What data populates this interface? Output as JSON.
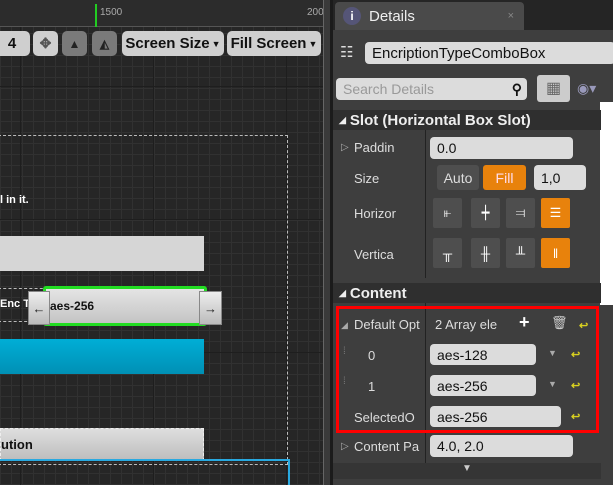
{
  "viewport": {
    "ruler_labels": [
      "1500",
      "200"
    ],
    "toolbar": {
      "dpi_value": "4",
      "screen_size": "Screen Size",
      "fill_screen": "Fill Screen"
    },
    "canvas": {
      "hint_text": "l in it.",
      "enc_label": "Enc Ty",
      "combo_value": "aes-256",
      "left_arrow": "←",
      "right_arrow": "→",
      "button_text": "ution"
    }
  },
  "details": {
    "tab_title": "Details",
    "close": "×",
    "widget_name": "EncriptionTypeComboBox",
    "search_placeholder": "Search Details",
    "slot_section": "Slot (Horizontal Box Slot)",
    "padding_label": "Paddin",
    "padding_value": "0.0",
    "size_label": "Size",
    "size_auto": "Auto",
    "size_fill": "Fill",
    "size_value": "1,0",
    "horizontal_label": "Horizor",
    "vertical_label": "Vertica",
    "content_section": "Content",
    "default_options_label": "Default Opt",
    "array_count": "2 Array ele",
    "options": [
      {
        "index": "0",
        "value": "aes-128"
      },
      {
        "index": "1",
        "value": "aes-256"
      }
    ],
    "selected_label": "SelectedO",
    "selected_value": "aes-256",
    "content_padding_label": "Content Pa",
    "content_padding_value": "4.0, 2.0"
  },
  "colors": {
    "accent": "#e8820c",
    "highlight": "#ff0000",
    "selection": "#22dd22",
    "blue_bar": "#00a3cc"
  }
}
